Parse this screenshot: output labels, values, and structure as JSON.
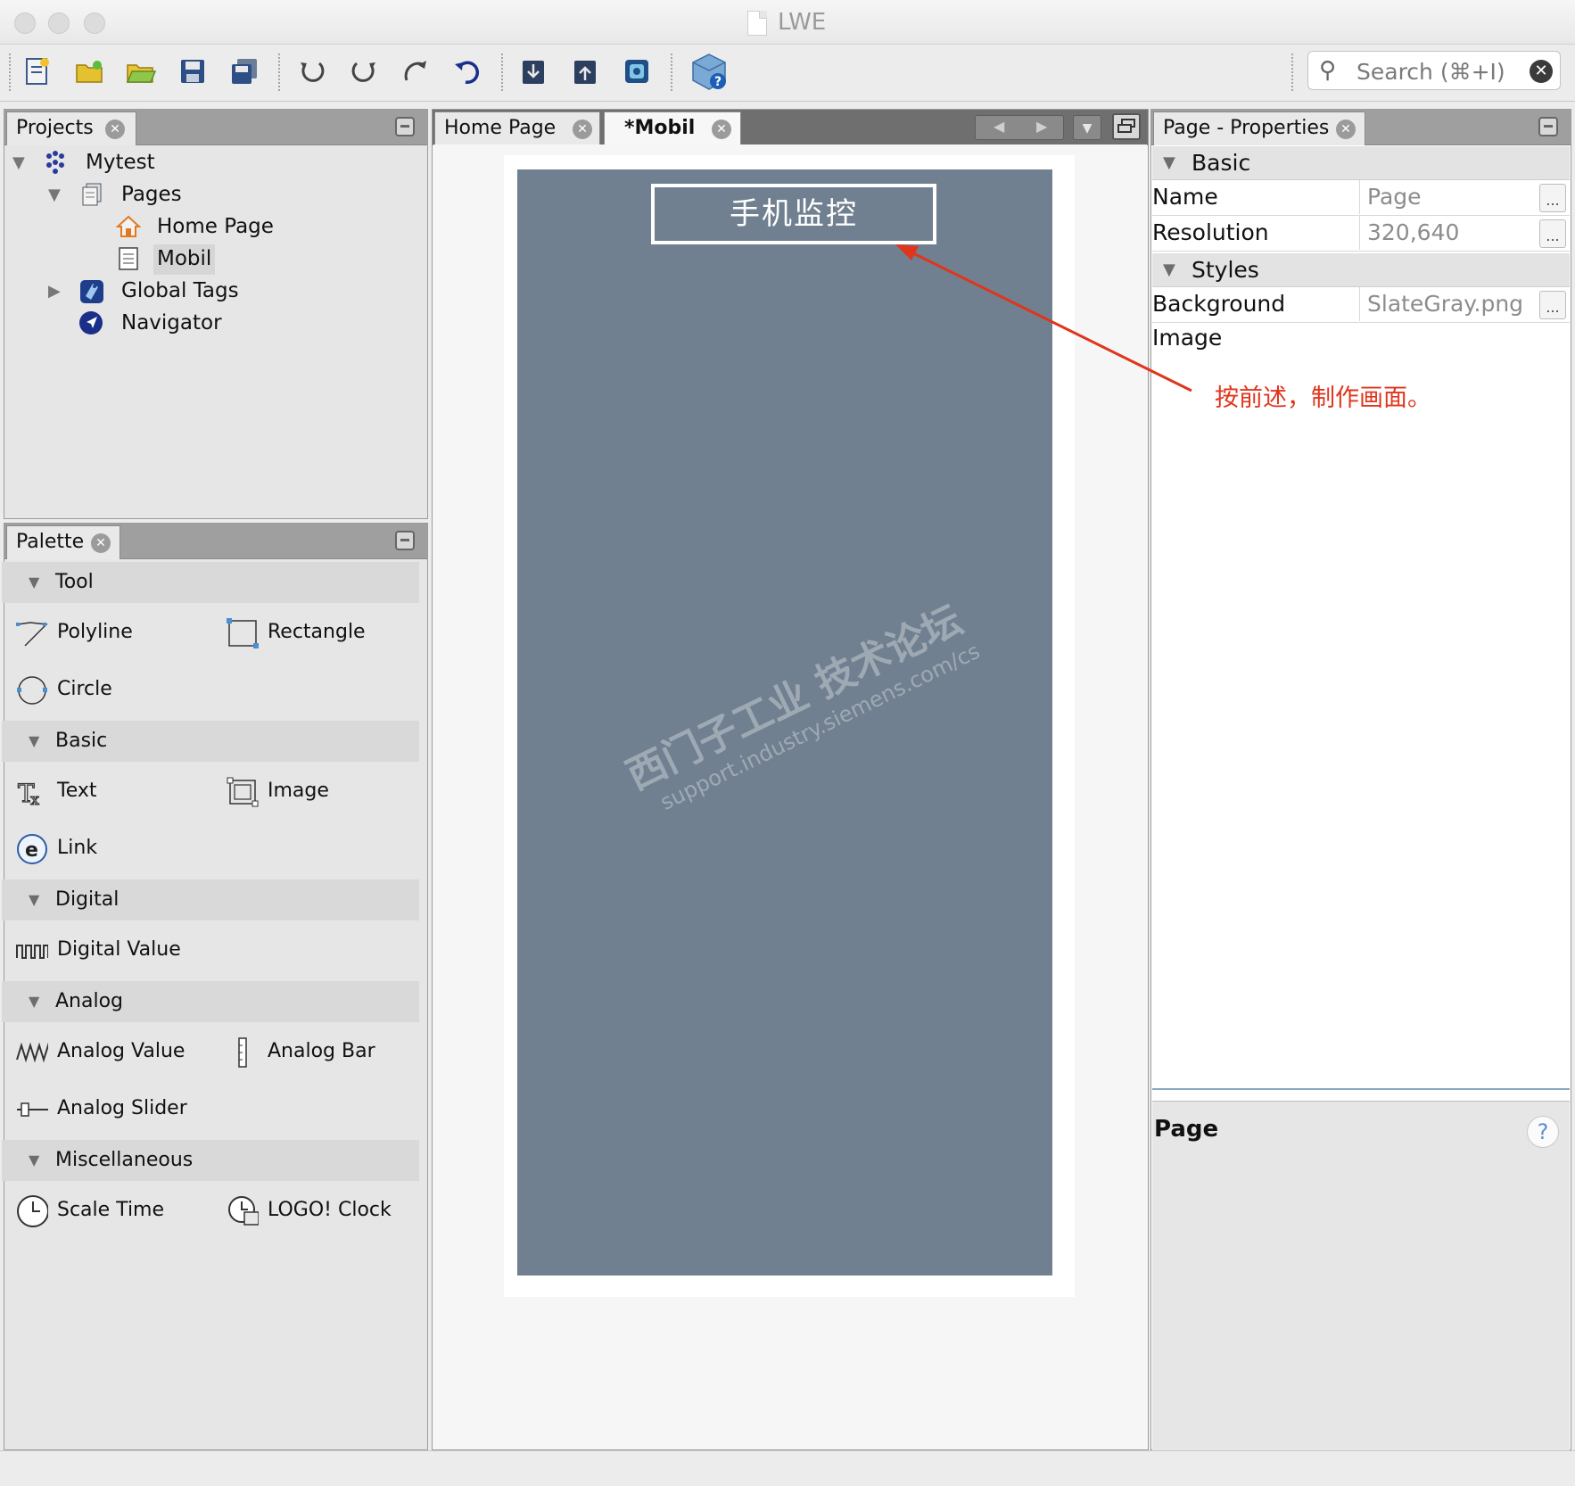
{
  "window": {
    "title": "LWE"
  },
  "toolbar": {
    "buttons": [
      "new-project-icon",
      "new-folder-icon",
      "open-folder-icon",
      "save-icon",
      "save-all-icon",
      "undo-icon",
      "refresh-icon",
      "redo-icon",
      "revert-icon",
      "download-icon",
      "upload-icon",
      "simulate-icon",
      "help-cube-icon"
    ],
    "search_placeholder": "Search (⌘+I)"
  },
  "projects": {
    "tab_label": "Projects",
    "tree": {
      "root": "Mytest",
      "pages_label": "Pages",
      "pages": [
        "Home Page",
        "Mobil"
      ],
      "selected_page": "Mobil",
      "global_tags": "Global Tags",
      "navigator": "Navigator"
    }
  },
  "palette": {
    "tab_label": "Palette",
    "sections": [
      {
        "name": "Tool",
        "items": [
          "Polyline",
          "Rectangle",
          "Circle"
        ]
      },
      {
        "name": "Basic",
        "items": [
          "Text",
          "Image",
          "Link"
        ]
      },
      {
        "name": "Digital",
        "items": [
          "Digital Value"
        ]
      },
      {
        "name": "Analog",
        "items": [
          "Analog Value",
          "Analog Bar",
          "Analog Slider"
        ]
      },
      {
        "name": "Miscellaneous",
        "items": [
          "Scale Time",
          "LOGO! Clock"
        ]
      }
    ]
  },
  "editor": {
    "tabs": [
      "Home Page",
      "*Mobil"
    ],
    "active_tab": "*Mobil",
    "page_title_text": "手机监控",
    "background_color": "#708090",
    "watermark_line1": "西门子工业 技术论坛",
    "watermark_line2": "support.industry.siemens.com/cs"
  },
  "properties": {
    "tab_label": "Page - Properties",
    "sections": {
      "basic": "Basic",
      "styles": "Styles"
    },
    "rows": {
      "name": {
        "key": "Name",
        "value": "Page"
      },
      "resolution": {
        "key": "Resolution",
        "value": "320,640"
      },
      "background_image": {
        "key": "Background Image",
        "value": "SlateGray.png"
      }
    },
    "footer_title": "Page",
    "help_glyph": "?"
  },
  "annotation": {
    "text": "按前述，制作画面。",
    "color": "#e0351d"
  }
}
